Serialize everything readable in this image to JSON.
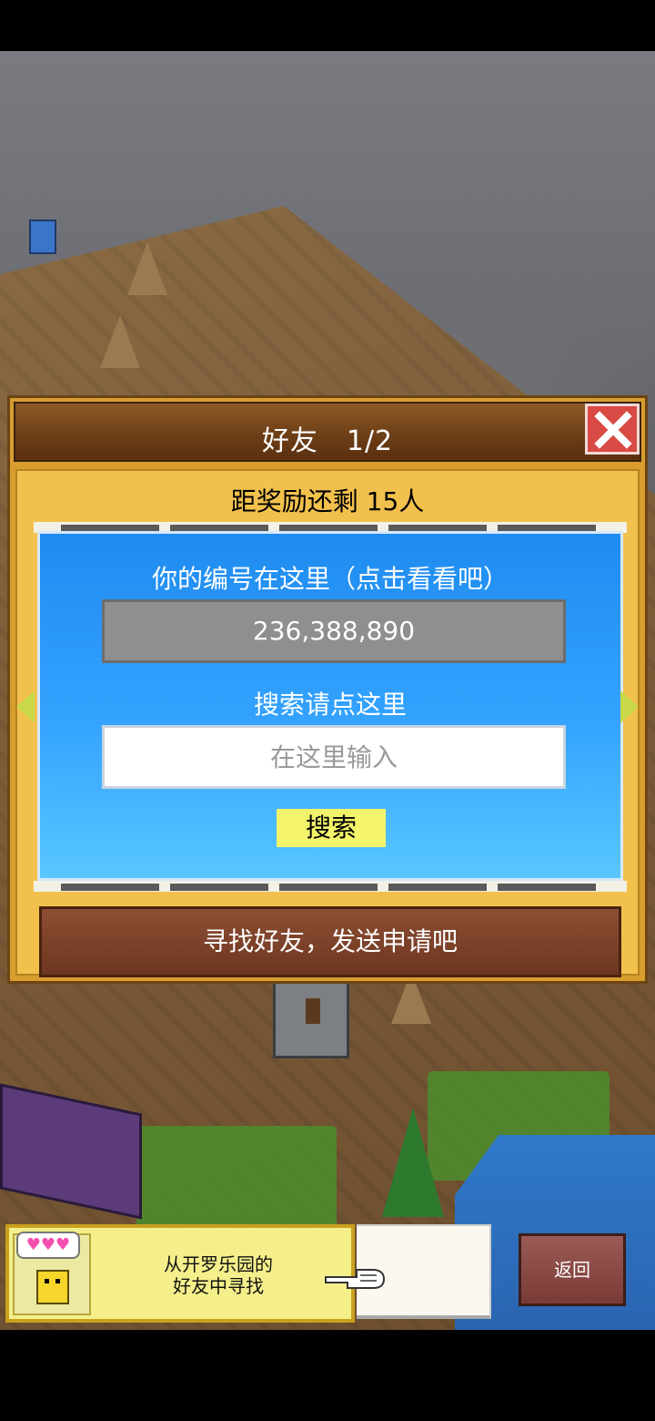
{
  "dialog": {
    "title": "好友　1/2",
    "reward_text": "距奖励还剩 15人",
    "id_label": "你的编号在这里（点击看看吧）",
    "id_value": "236,388,890",
    "search_label": "搜索请点这里",
    "search_placeholder": "在这里输入",
    "search_button": "搜索",
    "find_button": "寻找好友，发送申请吧"
  },
  "bottom": {
    "kairo_line1": "从开罗乐园的",
    "kairo_line2": "好友中寻找",
    "hearts": "♥♥♥",
    "back_button": "返回"
  },
  "icons": {
    "close": "close-icon",
    "left_arrow": "chevron-left-icon",
    "right_arrow": "chevron-right-icon",
    "pointer": "hand-pointer-icon"
  },
  "colors": {
    "dialog_gold": "#f2c14d",
    "title_brown": "#6b3d16",
    "panel_blue": "#34a3ff",
    "close_red": "#d84a43",
    "search_yellow": "#f4f46a"
  }
}
